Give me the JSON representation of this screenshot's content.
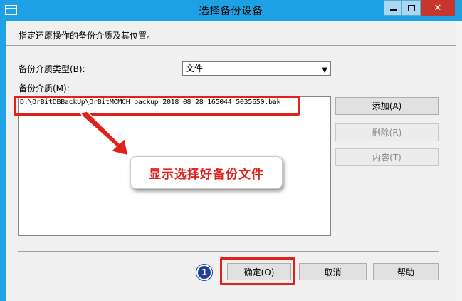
{
  "window": {
    "title": "选择备份设备",
    "min_label": "",
    "max_label": "",
    "close_label": "✕"
  },
  "dialog": {
    "instruction": "指定还原操作的备份介质及其位置。",
    "media_type_label": "备份介质类型(B):",
    "media_type_value": "文件",
    "media_label": "备份介质(M):",
    "media_items": [
      "D:\\OrBitDBBackUp\\OrBitMOMCH_backup_2018_08_28_165044_5035650.bak"
    ],
    "add_label": "添加(A)",
    "remove_label": "删除(R)",
    "contents_label": "内容(T)",
    "ok_label": "确定(O)",
    "cancel_label": "取消",
    "help_label": "帮助"
  },
  "annotations": {
    "callout_text": "显示选择好备份文件",
    "step_badge": "1",
    "highlight_color": "#e0221b",
    "badge_color": "#1f3f9a"
  },
  "colors": {
    "titlebar": "#1ea1e4",
    "close_button": "#c7362d",
    "dialog_bg": "#f0f0f0"
  }
}
